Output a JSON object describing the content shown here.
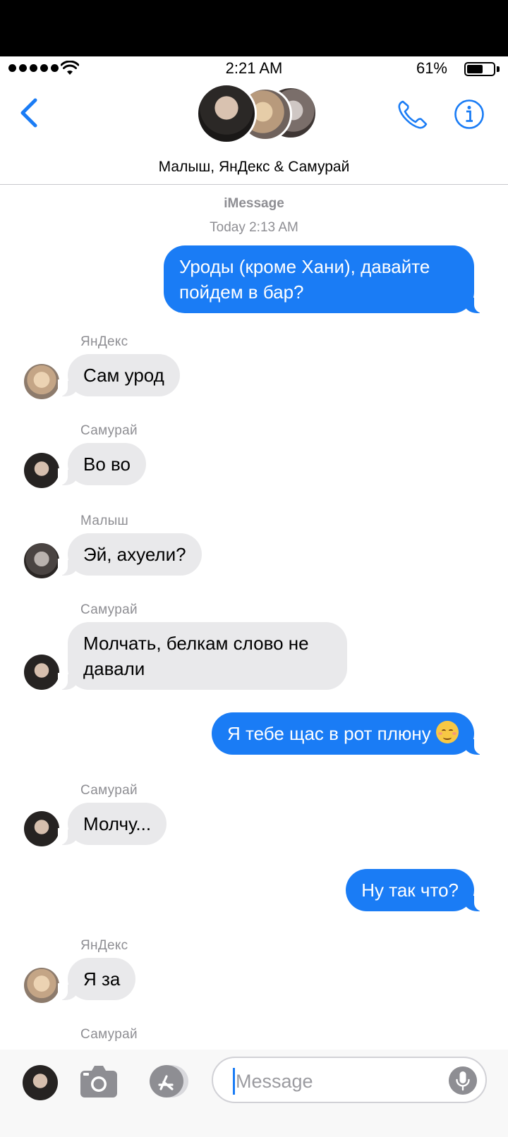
{
  "status_bar": {
    "time": "2:21 AM",
    "battery_percent": "61%",
    "battery_level": 0.61
  },
  "header": {
    "group_name": "Малыш, ЯнДекс & Самурай",
    "back_icon": "chevron-left-icon",
    "call_icon": "phone-icon",
    "info_icon": "info-icon"
  },
  "thread": {
    "service": "iMessage",
    "timestamp": "Today 2:13 AM"
  },
  "messages": [
    {
      "from": "me",
      "text": "Уроды (кроме Хани), давайте пойдем в бар?"
    },
    {
      "from": "ЯнДекс",
      "sender": "ЯнДекс",
      "text": "Сам урод"
    },
    {
      "from": "Самурай",
      "sender": "Самурай",
      "text": "Во во"
    },
    {
      "from": "Малыш",
      "sender": "Малыш",
      "text": "Эй, ахуели?"
    },
    {
      "from": "Самурай",
      "sender": "Самурай",
      "text": "Молчать, белкам слово не давали"
    },
    {
      "from": "me",
      "text": "Я тебе щас в рот плюну",
      "emoji": "relieved-face"
    },
    {
      "from": "Самурай",
      "sender": "Самурай",
      "text": "Молчу..."
    },
    {
      "from": "me",
      "text": "Ну так что?"
    },
    {
      "from": "ЯнДекс",
      "sender": "ЯнДекс",
      "text": "Я за"
    },
    {
      "from": "Самурай",
      "sender": "Самурай"
    }
  ],
  "composer": {
    "placeholder": "Message",
    "camera_icon": "camera-icon",
    "apps_icon": "app-store-icon",
    "mic_icon": "microphone-icon"
  },
  "colors": {
    "accent": "#1a7cf5",
    "incoming_bubble": "#e9e9eb",
    "meta_text": "#8e8e93"
  }
}
